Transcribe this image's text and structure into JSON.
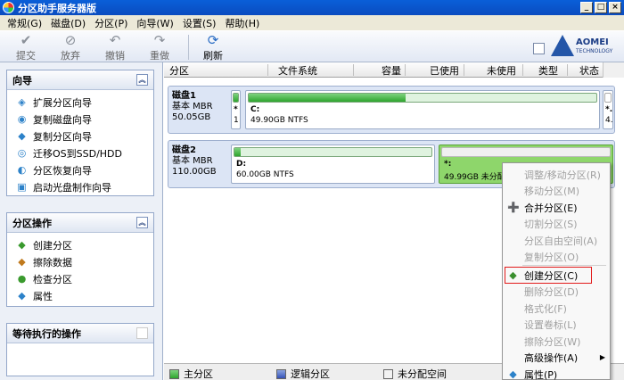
{
  "window": {
    "title": "分区助手服务器版"
  },
  "menu": [
    "常规(G)",
    "磁盘(D)",
    "分区(P)",
    "向导(W)",
    "设置(S)",
    "帮助(H)"
  ],
  "toolbar": {
    "commit": "提交",
    "discard": "放弃",
    "undo": "撤销",
    "redo": "重做",
    "refresh": "刷新"
  },
  "logo": {
    "brand": "AOMEI",
    "sub": "TECHNOLOGY"
  },
  "wizard_panel": {
    "title": "向导",
    "items": [
      "扩展分区向导",
      "复制磁盘向导",
      "复制分区向导",
      "迁移OS到SSD/HDD",
      "分区恢复向导",
      "启动光盘制作向导"
    ]
  },
  "partition_panel": {
    "title": "分区操作",
    "items": [
      "创建分区",
      "擦除数据",
      "检查分区",
      "属性"
    ]
  },
  "pending_panel": {
    "title": "等待执行的操作"
  },
  "columns": [
    "分区",
    "文件系统",
    "容量",
    "已使用",
    "未使用",
    "类型",
    "状态"
  ],
  "disks": [
    {
      "name": "磁盘1",
      "type": "基本 MBR",
      "size": "50.05GB",
      "small_part": {
        "label": "*",
        "num": "1"
      },
      "part": {
        "name": "C:",
        "desc": "49.90GB NTFS",
        "used_pct": 45
      },
      "right_part": {
        "label": "*.",
        "num": "4."
      }
    },
    {
      "name": "磁盘2",
      "type": "基本 MBR",
      "size": "110.00GB",
      "part": {
        "name": "D:",
        "desc": "60.00GB NTFS",
        "used_pct": 3
      },
      "unalloc": {
        "name": "*:",
        "desc": "49.99GB 未分配"
      }
    }
  ],
  "legend": [
    "主分区",
    "逻辑分区",
    "未分配空间"
  ],
  "context_menu": [
    {
      "label": "调整/移动分区(R)",
      "enabled": false
    },
    {
      "label": "移动分区(M)",
      "enabled": false
    },
    {
      "label": "合并分区(E)",
      "enabled": true
    },
    {
      "label": "切割分区(S)",
      "enabled": false
    },
    {
      "label": "分区自由空间(A)",
      "enabled": false
    },
    {
      "label": "复制分区(O)",
      "enabled": false
    },
    {
      "label": "创建分区(C)",
      "enabled": true
    },
    {
      "label": "删除分区(D)",
      "enabled": false
    },
    {
      "label": "格式化(F)",
      "enabled": false
    },
    {
      "label": "设置卷标(L)",
      "enabled": false
    },
    {
      "label": "擦除分区(W)",
      "enabled": false
    },
    {
      "label": "高级操作(A)",
      "enabled": true
    },
    {
      "label": "属性(P)",
      "enabled": true
    }
  ]
}
